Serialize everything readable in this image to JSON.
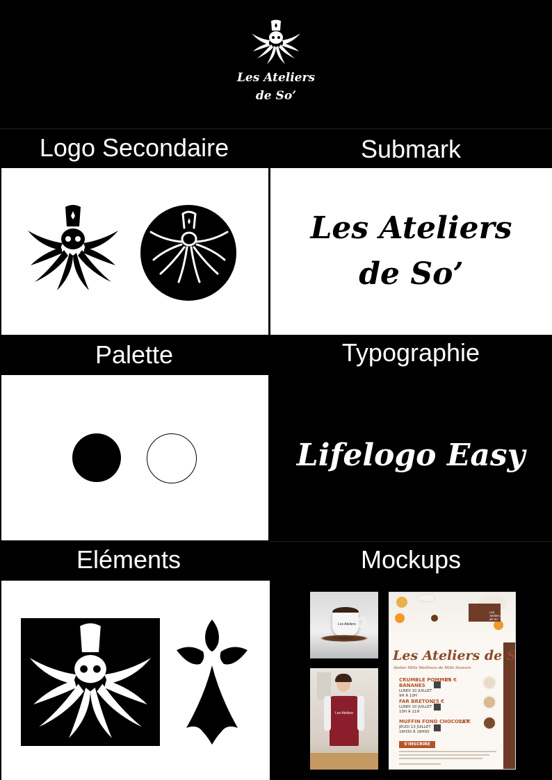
{
  "brand": {
    "line1": "Les Ateliers",
    "line2": "de So’"
  },
  "sections": {
    "logo_secondaire": "Logo Secondaire",
    "submark": "Submark",
    "palette": "Palette",
    "typographie": "Typographie",
    "elements": "Eléments",
    "mockups": "Mockups"
  },
  "typography": {
    "font_name": "Lifelogo Easy"
  },
  "palette_colors": [
    "#000000",
    "#ffffff"
  ],
  "poster": {
    "title": "Les Ateliers de So’",
    "subtitle": "Atelier Mille Meilleurs de Mille Saveurs",
    "logo_text": "Les Ateliers de So’",
    "items": [
      {
        "name": "CRUMBLE POMMES BANANES",
        "price": "25 €",
        "date": "LUNDI 10 JUILLET",
        "time": "9H À 10H"
      },
      {
        "name": "FAR BRETON",
        "price": "25 €",
        "date": "LUNDI 10 JUILLET",
        "time": "10H À 11H"
      },
      {
        "name": "MUFFIN FOND CHOCOLAT",
        "price": "25 €",
        "date": "JEUDI 13 JUILLET",
        "time": "16H30 À 18H00"
      }
    ],
    "cta": "S'INSCRIRE"
  },
  "icons": [
    "octopus-chef-icon",
    "ermine-icon"
  ]
}
